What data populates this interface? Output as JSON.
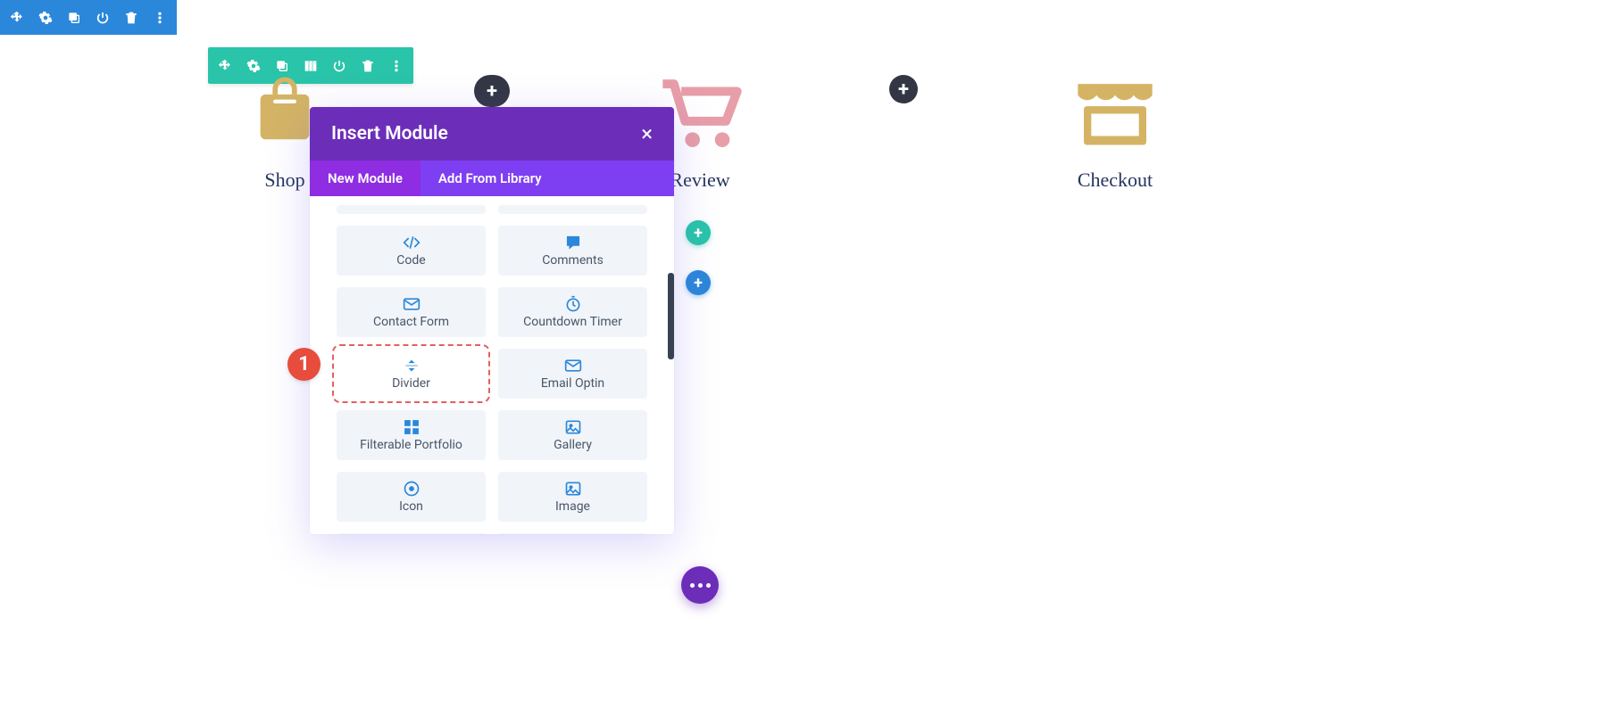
{
  "toolbars": {
    "blue": [
      "move",
      "settings",
      "duplicate",
      "power",
      "delete",
      "more"
    ],
    "green": [
      "move",
      "settings",
      "duplicate",
      "columns",
      "power",
      "delete",
      "more"
    ]
  },
  "columns": [
    {
      "label": "Shop",
      "icon": "shopping-bag"
    },
    {
      "label": "Review",
      "icon": "cart"
    },
    {
      "label": "Checkout",
      "icon": "storefront"
    }
  ],
  "modal": {
    "title": "Insert Module",
    "tabs": [
      {
        "label": "New Module",
        "active": true
      },
      {
        "label": "Add From Library",
        "active": false
      }
    ],
    "modules": [
      {
        "label": "Code",
        "icon": "code"
      },
      {
        "label": "Comments",
        "icon": "chat"
      },
      {
        "label": "Contact Form",
        "icon": "mail"
      },
      {
        "label": "Countdown Timer",
        "icon": "clock"
      },
      {
        "label": "Divider",
        "icon": "divider",
        "highlighted": true
      },
      {
        "label": "Email Optin",
        "icon": "mail"
      },
      {
        "label": "Filterable Portfolio",
        "icon": "grid"
      },
      {
        "label": "Gallery",
        "icon": "image"
      },
      {
        "label": "Icon",
        "icon": "target"
      },
      {
        "label": "Image",
        "icon": "image"
      }
    ]
  },
  "badge": "1",
  "colors": {
    "blue": "#2b87da",
    "green": "#29c4a9",
    "purple": "#6c2eb9",
    "red": "#e74c3c",
    "tan": "#d4b464",
    "pink": "#e89ea8"
  }
}
